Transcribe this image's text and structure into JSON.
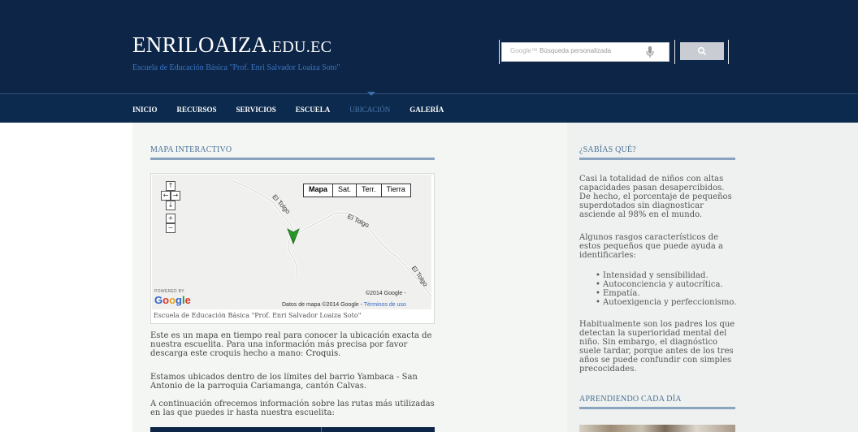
{
  "header": {
    "brand_main": "ENRILOAIZA",
    "brand_suffix": ".EDU.EC",
    "subtitle": "Escuela de Educación Básica \"Prof. Enri Salvador Loaiza Soto\"",
    "search": {
      "brand": "Google™",
      "placeholder": "Búsqueda personalizada"
    }
  },
  "nav": {
    "items": [
      {
        "label": "INICIO"
      },
      {
        "label": "RECURSOS"
      },
      {
        "label": "SERVICIOS"
      },
      {
        "label": "ESCUELA"
      },
      {
        "label": "UBICACIÓN"
      },
      {
        "label": "GALERÍA"
      }
    ],
    "active_index": 4
  },
  "main": {
    "title": "MAPA INTERACTIVO",
    "map": {
      "types": [
        "Mapa",
        "Sat.",
        "Terr.",
        "Tierra"
      ],
      "active_type": "Mapa",
      "road_label_1": "El Tolgo",
      "road_label_2": "El Tolgo",
      "road_label_3": "El Tolgo",
      "powered_by": "POWERED BY",
      "google": "Google",
      "copyright": "©2014 Google -",
      "data_text": "Datos de mapa ©2014 Google -",
      "terms": "Términos de uso",
      "caption": "Escuela de Educación Básica \"Prof. Enri Salvador Loaiza Soto\""
    },
    "para1_text": "Este es un mapa en tiempo real para conocer la ubicación exacta de nuestra escuelita. Para una información más precisa por favor descarga este croquis hecho a mano: ",
    "para1_link": "Croquis",
    "para1_end": ".",
    "para2": "Estamos ubicados dentro de los límites del barrio Yambaca - San Antonio de la parroquia Cariamanga, cantón Calvas.",
    "para3": "A continuación ofrecemos información sobre las rutas más utilizadas en las que puedes ir hasta nuestra escuelita:"
  },
  "sidebar": {
    "title1": "¿SABÍAS QUÉ?",
    "para1": "Casi la totalidad de niños con altas capacidades pasan desapercibidos. De hecho, el porcentaje de pequeños superdotados sin diagnosticar asciende al 98% en el mundo.",
    "para2": "Algunos rasgos característicos de estos pequeños que puede ayuda a identificarles:",
    "list": [
      "Intensidad y sensibilidad.",
      "Autoconciencia y autocrítica.",
      "Empatía.",
      "Autoexigencia y perfeccionismo."
    ],
    "para3": "Habitualmente son los padres los que detectan la superioridad mental del niño. Sin embargo, el diagnóstico suele tardar, porque antes de los tres años se puede confundir con simples precocidades.",
    "title2": "APRENDIENDO CADA DÍA"
  },
  "colors": {
    "header_bg": "#0d2648",
    "nav_active": "#4c79b1",
    "subtitle": "#3a73c2",
    "marker": "#2a9a2a"
  }
}
